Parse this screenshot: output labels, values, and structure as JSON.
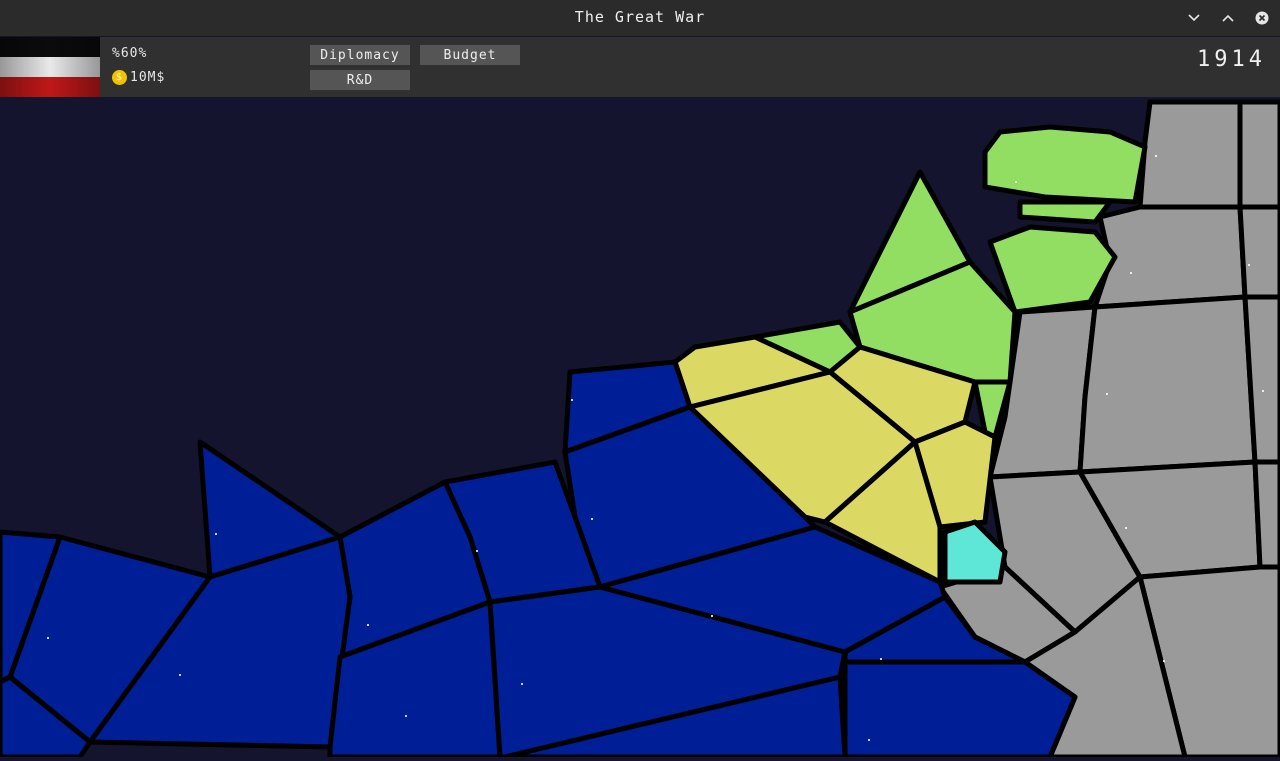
{
  "window": {
    "title": "The Great War"
  },
  "hud": {
    "approval": "%60%",
    "money": "10M$",
    "coin_symbol": "$",
    "year": "1914",
    "buttons": {
      "diplomacy": "Diplomacy",
      "budget": "Budget",
      "research": "R&D"
    }
  },
  "colors": {
    "sea": "#14142e",
    "nation_blue": "#001e96",
    "nation_green": "#92de62",
    "nation_yellow": "#dcd864",
    "nation_cyan": "#5ee6d6",
    "nation_gray": "#9a9a9a",
    "border": "#000000"
  }
}
